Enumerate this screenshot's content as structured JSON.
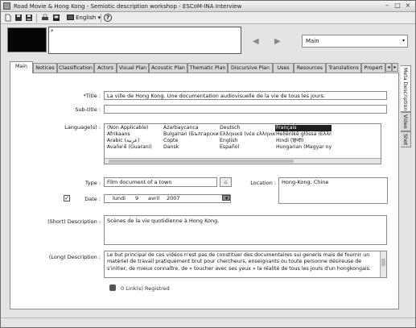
{
  "window": {
    "title": "Road Movie & Hong Kong - Semiotic description workshop - ESCoM-INA Interview",
    "minimize_glyph": "–",
    "maximize_glyph": "□",
    "close_glyph": "×"
  },
  "toolbar": {
    "language": "English",
    "help_glyph": "?"
  },
  "notes_marker": "*",
  "nav": {
    "back_glyph": "◀",
    "forward_glyph": "▶"
  },
  "context_select": {
    "value": "Main",
    "arrow": "▾"
  },
  "tabs": [
    {
      "label": "Main"
    },
    {
      "label": "Notices"
    },
    {
      "label": "Classification"
    },
    {
      "label": "Actors"
    },
    {
      "label": "Visual Plan"
    },
    {
      "label": "Acoustic Plan"
    },
    {
      "label": "Thematic Plan"
    },
    {
      "label": "Discursive Plan"
    },
    {
      "label": "Uses"
    },
    {
      "label": "Resources"
    },
    {
      "label": "Translations"
    },
    {
      "label": "Propert"
    }
  ],
  "tab_scroll": {
    "left": "◂",
    "right": "▸"
  },
  "side_tabs": [
    {
      "label": "Meta Description"
    },
    {
      "label": "Video"
    },
    {
      "label": "Shot"
    }
  ],
  "form": {
    "title_label": "*Title :",
    "title_value": "La ville de Hong Kong. Une documentation audiovisuelle de la vie de tous les jours.",
    "subtitle_label": "Sub-title :",
    "subtitle_value": "",
    "language_label": "Language(s) :",
    "language_columns": [
      [
        "(Non Applicable)",
        "Afrikaans",
        "Arabic (عربية)",
        "Avañe'ẽ (Guarani)"
      ],
      [
        "Azərbaycanca",
        "Bulgarian (Български)",
        "Copte",
        "Dansk"
      ],
      [
        "Deutsch",
        "Ελληνικά (νέα ελληνικά)",
        "English",
        "Español"
      ],
      [
        "Français",
        "Hellēnikḗ glōssa (Ελλην",
        "Hindi (हिन्दी)",
        "Hungarian (Magyar nyelv)"
      ]
    ],
    "selected_language": "Français",
    "type_label": "Type :",
    "type_value": "Film document of a town",
    "type_button_glyph": "⌂",
    "location_label": "Location :",
    "location_value": "Hong-Kong, Chine",
    "date_checkbox_glyph": "✓",
    "date_label": "Date :",
    "date_day_name": "lundi",
    "date_day": "9",
    "date_month": "avril",
    "date_year": "2007",
    "date_arrow": "▾",
    "short_desc_label": "(Short) Description :",
    "short_desc_value": "Scènes de la vie quotidienne à Hong Kong.",
    "long_desc_label": "(Long) Description :",
    "long_desc_value": "Le but principal de ces vidéos n'est pas de constituer des documentaires sui generis mais de fournir un matériel de travail pratiquement brut pour chercheurs, enseignants ou toute personne désireuse de s'initier, de mieux connaître, de « toucher avec ses yeux » la réalité de tous les jours d'un hongkongais.",
    "links_text": "0 Link(s) Registred"
  }
}
